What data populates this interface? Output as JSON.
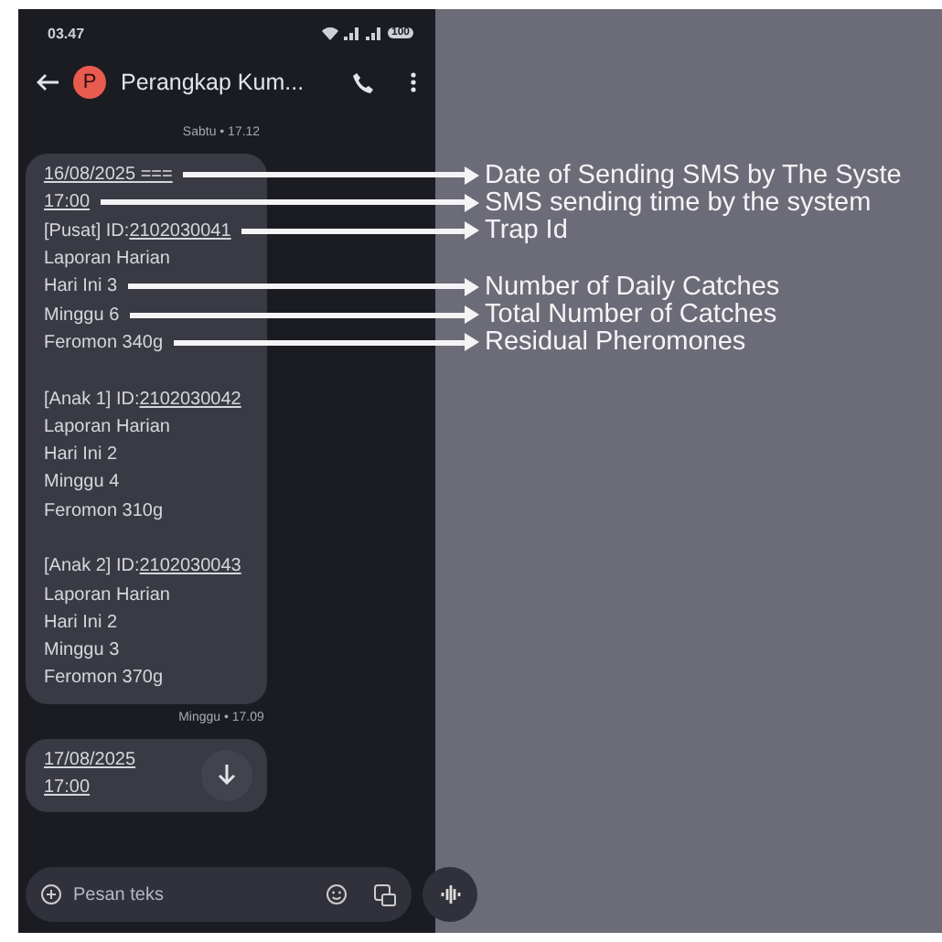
{
  "status_bar": {
    "time": "03.47",
    "battery": "100"
  },
  "header": {
    "avatar": "P",
    "title": "Perangkap Kum..."
  },
  "feed": [
    {
      "kind": "separator",
      "text": "Sabtu • 17.12"
    },
    {
      "kind": "message",
      "sections": [
        [
          {
            "link": "16/08/2025 ===",
            "annotation": "Date of Sending SMS by The Syste"
          },
          {
            "link": "17:00",
            "annotation": "SMS sending time by the system"
          },
          {
            "text": "[Pusat] ID:",
            "link": "2102030041",
            "annotation": "Trap Id"
          },
          {
            "text": "Laporan Harian"
          },
          {
            "text": "Hari Ini 3",
            "annotation": "Number of Daily Catches"
          },
          {
            "text": "Minggu 6",
            "annotation": "Total Number of Catches"
          },
          {
            "text": "Feromon 340g",
            "annotation": "Residual Pheromones"
          }
        ],
        [
          {
            "text": "[Anak 1] ID:",
            "link": "2102030042"
          },
          {
            "text": "Laporan Harian"
          },
          {
            "text": "Hari Ini 2"
          },
          {
            "text": "Minggu 4"
          },
          {
            "text": "Feromon 310g"
          }
        ],
        [
          {
            "text": "[Anak 2] ID:",
            "link": "2102030043"
          },
          {
            "text": "Laporan Harian"
          },
          {
            "text": "Hari Ini 2"
          },
          {
            "text": "Minggu 3"
          },
          {
            "text": "Feromon 370g"
          }
        ]
      ]
    },
    {
      "kind": "separator",
      "text": "Minggu • 17.09"
    },
    {
      "kind": "message",
      "scroll_button": true,
      "sections": [
        [
          {
            "link": "17/08/2025"
          },
          {
            "link": "17:00"
          }
        ]
      ]
    }
  ],
  "compose": {
    "placeholder": "Pesan teks"
  }
}
